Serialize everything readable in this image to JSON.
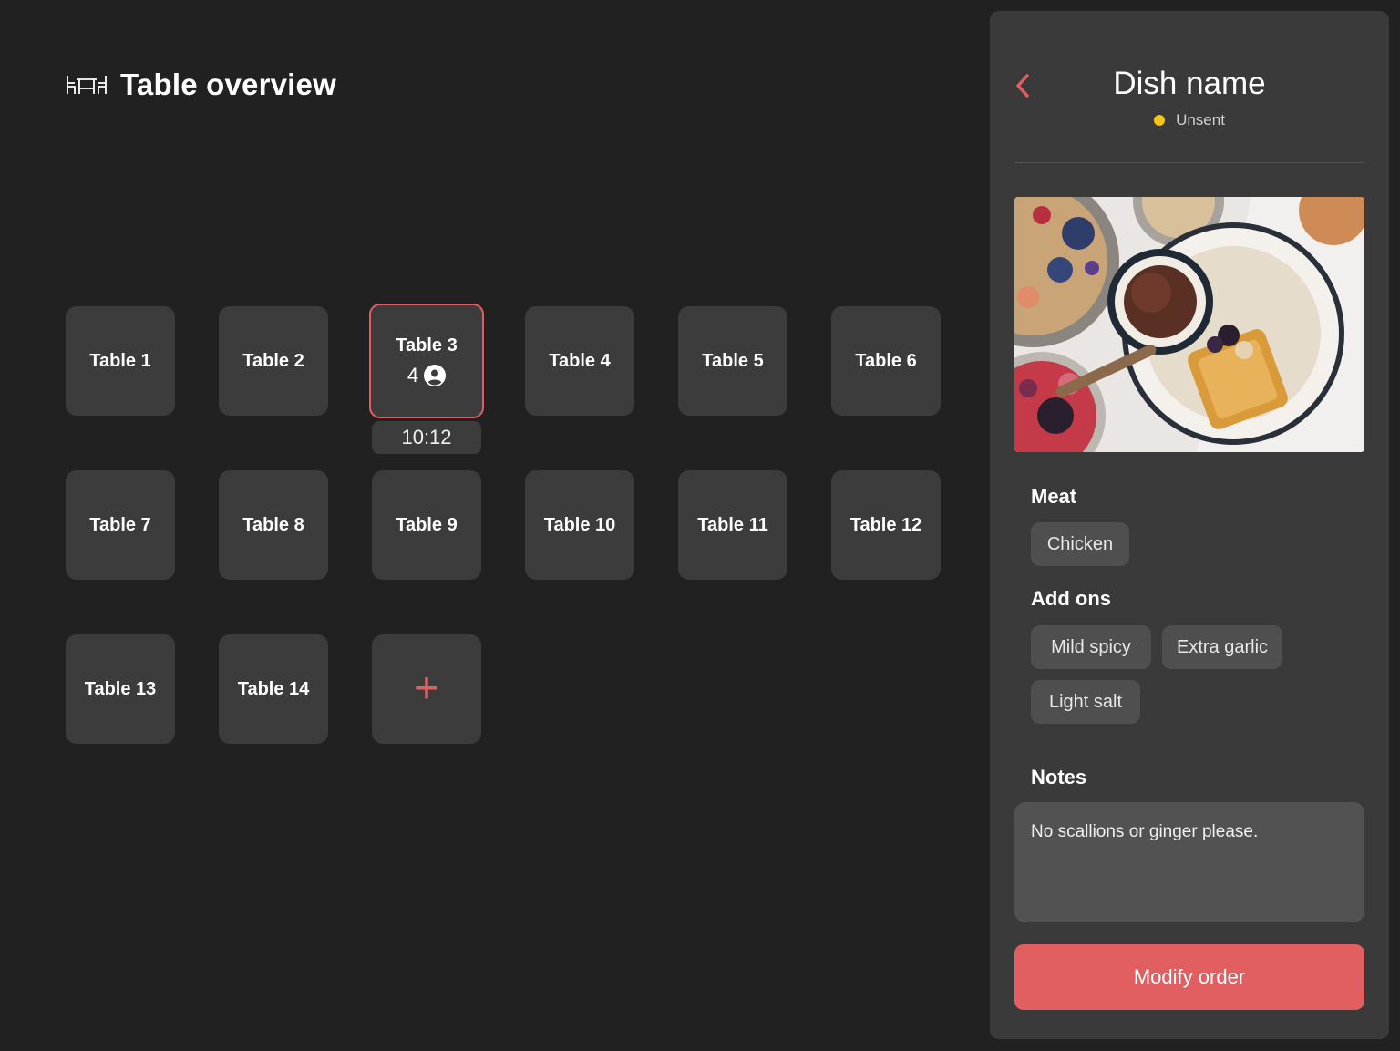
{
  "header": {
    "title": "Table overview",
    "icon": "table-chairs-icon"
  },
  "tables": [
    {
      "label": "Table 1"
    },
    {
      "label": "Table 2"
    },
    {
      "label": "Table 3",
      "guests": "4",
      "timer": "10:12",
      "active": true
    },
    {
      "label": "Table 4"
    },
    {
      "label": "Table 5"
    },
    {
      "label": "Table 6"
    },
    {
      "label": "Table 7"
    },
    {
      "label": "Table 8"
    },
    {
      "label": "Table 9"
    },
    {
      "label": "Table 10"
    },
    {
      "label": "Table 11"
    },
    {
      "label": "Table 12"
    },
    {
      "label": "Table 13"
    },
    {
      "label": "Table 14"
    }
  ],
  "add_table": {
    "label": "+"
  },
  "panel": {
    "dish_name": "Dish name",
    "status": "Unsent",
    "status_color": "#f5c518",
    "meat_label": "Meat",
    "meat_options": [
      "Chicken"
    ],
    "addons_label": "Add ons",
    "addons": [
      "Mild spicy",
      "Extra garlic",
      "Light salt"
    ],
    "notes_label": "Notes",
    "notes": "No scallions or ginger please.",
    "modify_button": "Modify order"
  },
  "colors": {
    "accent": "#e25f61",
    "background": "#212121",
    "tile": "#3c3c3c",
    "panel": "#3a3a3a"
  }
}
